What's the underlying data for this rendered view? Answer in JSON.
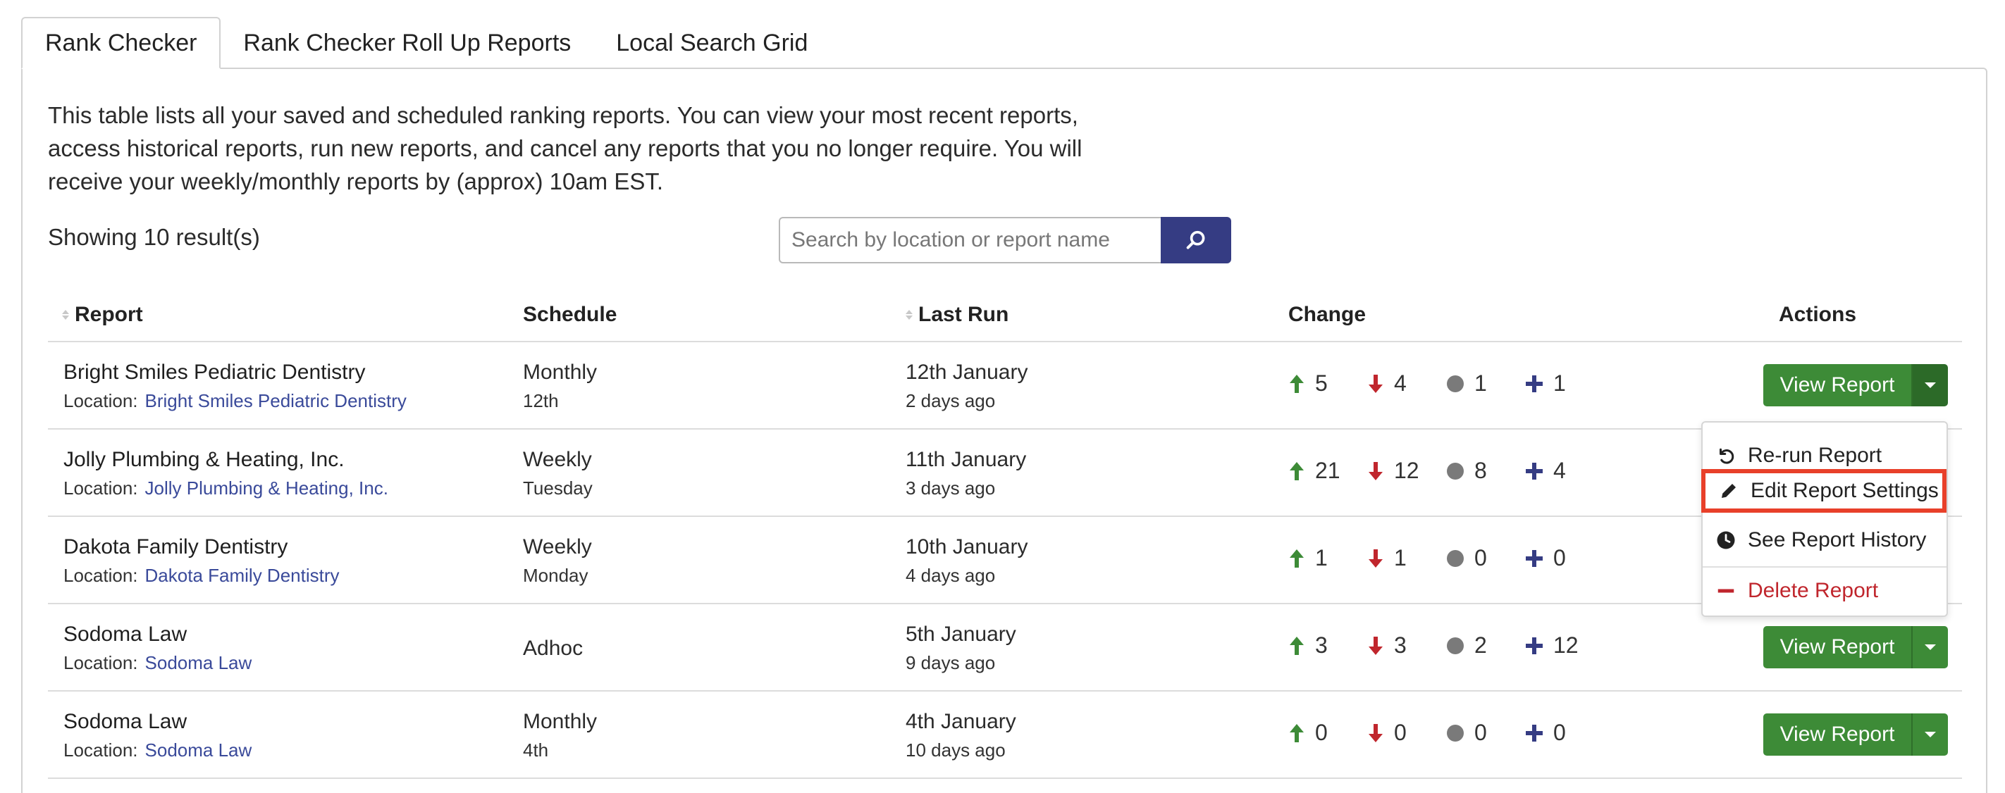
{
  "tabs": [
    "Rank Checker",
    "Rank Checker Roll Up Reports",
    "Local Search Grid"
  ],
  "intro": "This table lists all your saved and scheduled ranking reports. You can view your most recent reports, access historical reports, run new reports, and cancel any reports that you no longer require. You will receive your weekly/monthly reports by (approx) 10am EST.",
  "result_count": "Showing 10 result(s)",
  "search": {
    "placeholder": "Search by location or report name",
    "icon": "search-icon"
  },
  "columns": {
    "report": "Report",
    "schedule": "Schedule",
    "last_run": "Last Run",
    "change": "Change",
    "actions": "Actions"
  },
  "location_label": "Location:",
  "rows": [
    {
      "name": "Bright Smiles Pediatric Dentistry",
      "location": "Bright Smiles Pediatric Dentistry",
      "schedule": "Monthly",
      "schedule_detail": "12th",
      "last_run": "12th January",
      "ago": "2 days ago",
      "up": "5",
      "down": "4",
      "same": "1",
      "new": "1"
    },
    {
      "name": "Jolly Plumbing & Heating, Inc.",
      "location": "Jolly Plumbing & Heating, Inc.",
      "schedule": "Weekly",
      "schedule_detail": "Tuesday",
      "last_run": "11th January",
      "ago": "3 days ago",
      "up": "21",
      "down": "12",
      "same": "8",
      "new": "4"
    },
    {
      "name": "Dakota Family Dentistry",
      "location": "Dakota Family Dentistry",
      "schedule": "Weekly",
      "schedule_detail": "Monday",
      "last_run": "10th January",
      "ago": "4 days ago",
      "up": "1",
      "down": "1",
      "same": "0",
      "new": "0"
    },
    {
      "name": "Sodoma Law",
      "location": "Sodoma Law",
      "schedule": "Adhoc",
      "schedule_detail": "",
      "last_run": "5th January",
      "ago": "9 days ago",
      "up": "3",
      "down": "3",
      "same": "2",
      "new": "12"
    },
    {
      "name": "Sodoma Law",
      "location": "Sodoma Law",
      "schedule": "Monthly",
      "schedule_detail": "4th",
      "last_run": "4th January",
      "ago": "10 days ago",
      "up": "0",
      "down": "0",
      "same": "0",
      "new": "0"
    }
  ],
  "view_report_label": "View Report",
  "dropdown": {
    "rerun": "Re-run Report",
    "edit": "Edit Report Settings",
    "history": "See Report History",
    "delete": "Delete Report"
  },
  "colors": {
    "accent": "#353c83",
    "green": "#3d8b37",
    "up": "#3d8b37",
    "down": "#c0262d",
    "same": "#7a7a7a",
    "new": "#353c83",
    "highlight": "#e8402a"
  }
}
